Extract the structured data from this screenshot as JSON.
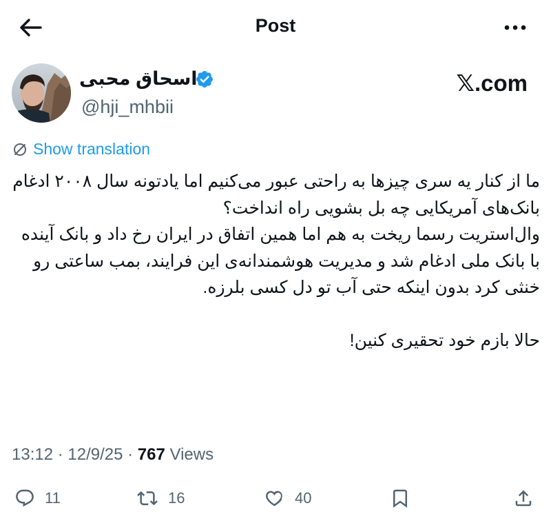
{
  "header": {
    "title": "Post",
    "back_icon": "arrow-left-icon",
    "more_icon": "more-horizontal-icon"
  },
  "author": {
    "display_name": "اسحاق محبی",
    "handle": "@hji_mhbii",
    "verified": true,
    "verified_color": "#1d9bf0"
  },
  "brand": {
    "x": "𝕏",
    "suffix": ".com"
  },
  "translation": {
    "label": "Show translation",
    "color": "#1d9bf0"
  },
  "tweet": {
    "text": "ما از کنار یه سری چیزها به راحتی عبور می‌کنیم اما یادتونه سال ۲۰۰۸ ادغام بانک‌های آمریکایی چه بل بشویی راه انداخت؟\nوال‌استریت رسما ریخت به هم اما همین اتفاق در ایران رخ داد و بانک آینده با بانک ملی ادغام شد و مدیریت هوشمندانه‌ی این فرایند، بمب ساعتی رو خنثی کرد بدون اینکه حتی آب تو دل کسی بلرزه.\n\nحالا بازم خود تحقیری کنین!"
  },
  "meta": {
    "time": "13:12",
    "date": "12/9/25",
    "separator": " · ",
    "views_count": "767",
    "views_label": " Views"
  },
  "actions": {
    "replies": "11",
    "reposts": "16",
    "likes": "40"
  }
}
